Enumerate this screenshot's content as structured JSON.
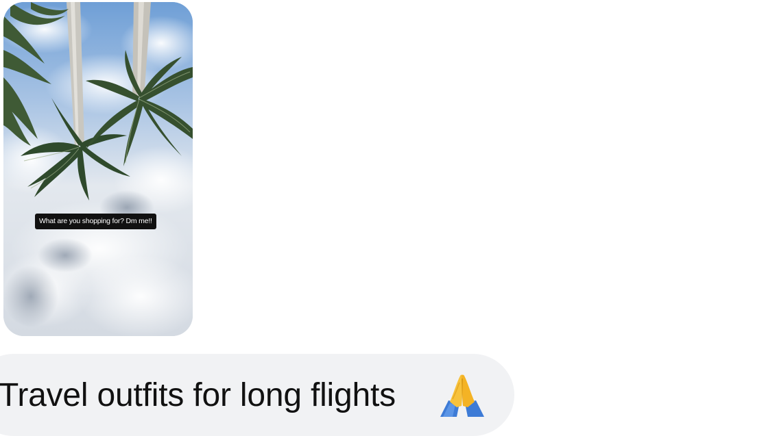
{
  "story": {
    "caption": "What are you shopping for? Dm me!!"
  },
  "message": {
    "text": "Travel outfits for long flights",
    "emoji_icon": "folded-hands-icon"
  }
}
